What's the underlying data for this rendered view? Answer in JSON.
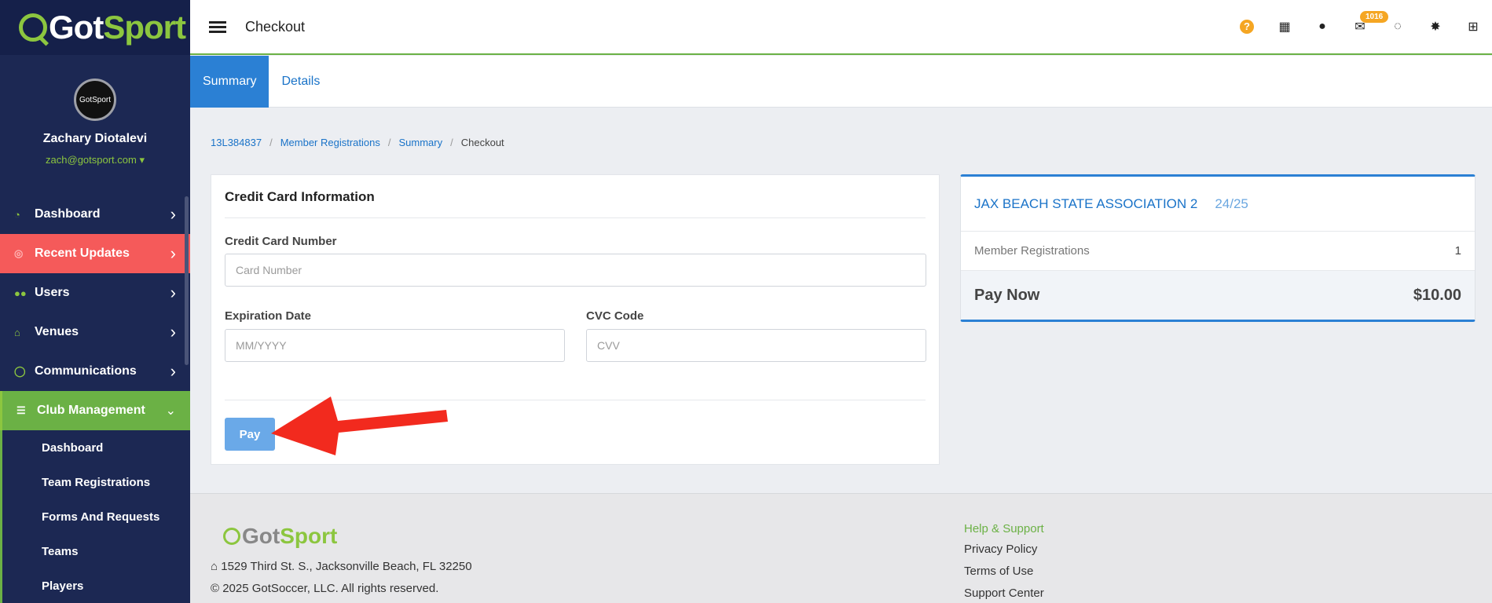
{
  "brand": {
    "logo_part1": "Got",
    "logo_part2": "Sport",
    "avatar_text": "GotSport"
  },
  "profile": {
    "name": "Zachary Diotalevi",
    "email": "zach@gotsport.com ▾"
  },
  "sidebar": {
    "items": [
      {
        "label": "Dashboard",
        "icon": "dashboard-icon"
      },
      {
        "label": "Recent Updates",
        "icon": "updates-icon"
      },
      {
        "label": "Users",
        "icon": "users-icon"
      },
      {
        "label": "Venues",
        "icon": "home-icon"
      },
      {
        "label": "Communications",
        "icon": "comments-icon"
      },
      {
        "label": "Club Management",
        "icon": "club-icon"
      }
    ],
    "sub_items": [
      "Dashboard",
      "Team Registrations",
      "Forms And Requests",
      "Teams",
      "Players"
    ]
  },
  "topbar": {
    "title": "Checkout",
    "mail_badge": "1016",
    "icons": [
      "help-icon",
      "qr-code-icon",
      "user-icon",
      "mail-icon",
      "chat-icon",
      "gear-icon",
      "apps-grid-icon"
    ]
  },
  "tabs": [
    "Summary",
    "Details"
  ],
  "breadcrumb": [
    "13L384837",
    "Member Registrations",
    "Summary",
    "Checkout"
  ],
  "breadcrumb_sep": "/",
  "form": {
    "title": "Credit Card Information",
    "card_label": "Credit Card Number",
    "card_placeholder": "Card Number",
    "exp_label": "Expiration Date",
    "exp_placeholder": "MM/YYYY",
    "cvc_label": "CVC Code",
    "cvc_placeholder": "CVV",
    "pay_label": "Pay"
  },
  "summary": {
    "association": "JAX BEACH STATE ASSOCIATION 2",
    "season": "24/25",
    "line_label": "Member Registrations",
    "line_value": "1",
    "total_label": "Pay Now",
    "total_value": "$10.00"
  },
  "footer": {
    "address": "1529 Third St. S., Jacksonville Beach, FL 32250",
    "copyright": "© 2025 GotSoccer, LLC. All rights reserved.",
    "links_heading": "Help & Support",
    "links": [
      "Privacy Policy",
      "Terms of Use",
      "Support Center"
    ]
  },
  "colors": {
    "brand_green": "#8cc63f",
    "primary_blue": "#2b80d4",
    "alert_red": "#f55a5a",
    "annotation_arrow": "#f22a1e"
  }
}
